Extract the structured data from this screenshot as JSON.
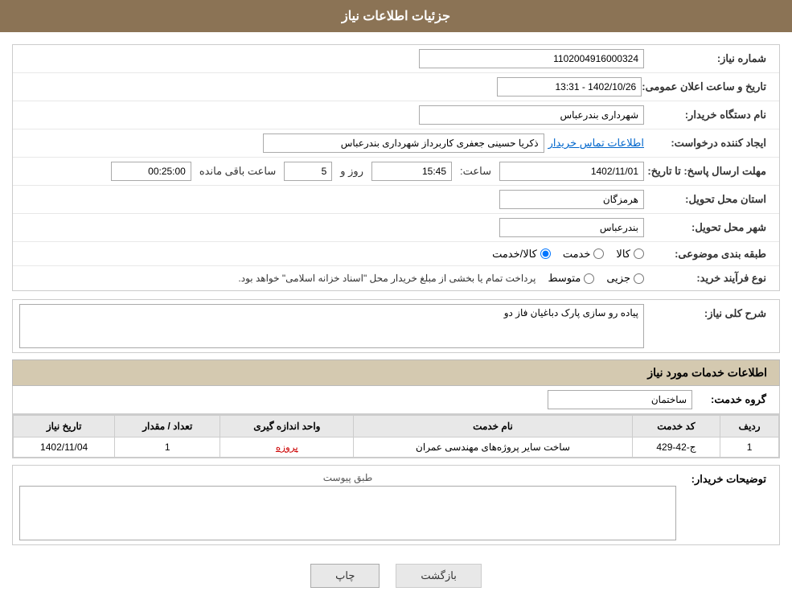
{
  "header": {
    "title": "جزئیات اطلاعات نیاز"
  },
  "form": {
    "need_number_label": "شماره نیاز:",
    "need_number_value": "1102004916000324",
    "announcement_label": "تاریخ و ساعت اعلان عمومی:",
    "announcement_value": "1402/10/26 - 13:31",
    "buyer_org_label": "نام دستگاه خریدار:",
    "buyer_org_value": "شهرداری بندرعباس",
    "creator_label": "ایجاد کننده درخواست:",
    "creator_value": "ذکریا حسینی جعفری کاربرداز شهرداری بندرعباس",
    "creator_link": "اطلاعات تماس خریدار",
    "reply_deadline_label": "مهلت ارسال پاسخ: تا تاریخ:",
    "reply_date": "1402/11/01",
    "reply_time_label": "ساعت:",
    "reply_time": "15:45",
    "reply_days_label": "روز و",
    "reply_days": "5",
    "reply_remaining_label": "ساعت باقی مانده",
    "reply_remaining": "00:25:00",
    "province_label": "استان محل تحویل:",
    "province_value": "هرمزگان",
    "city_label": "شهر محل تحویل:",
    "city_value": "بندرعباس",
    "category_label": "طبقه بندی موضوعی:",
    "category_options": [
      "کالا",
      "خدمت",
      "کالا/خدمت"
    ],
    "category_selected": "کالا/خدمت",
    "purchase_type_label": "نوع فرآیند خرید:",
    "purchase_type_options": [
      "جزیی",
      "متوسط"
    ],
    "purchase_type_note": "پرداخت تمام یا بخشی از مبلغ خریدار محل \"اسناد خزانه اسلامی\" خواهد بود.",
    "description_label": "شرح کلی نیاز:",
    "description_value": "پیاده رو سازی پارک دباغیان فاز دو"
  },
  "services": {
    "section_title": "اطلاعات خدمات مورد نیاز",
    "group_label": "گروه خدمت:",
    "group_value": "ساختمان",
    "table": {
      "columns": [
        "ردیف",
        "کد خدمت",
        "نام خدمت",
        "واحد اندازه گیری",
        "تعداد / مقدار",
        "تاریخ نیاز"
      ],
      "rows": [
        {
          "row_num": "1",
          "code": "ج-42-429",
          "name": "ساخت سایر پروژه‌های مهندسی عمران",
          "unit": "پروزه",
          "quantity": "1",
          "date": "1402/11/04"
        }
      ]
    }
  },
  "buyer_notes": {
    "label": "توضیحات خریدار:",
    "attachment_label": "طبق پیوست",
    "content": ""
  },
  "buttons": {
    "print": "چاپ",
    "back": "بازگشت"
  }
}
